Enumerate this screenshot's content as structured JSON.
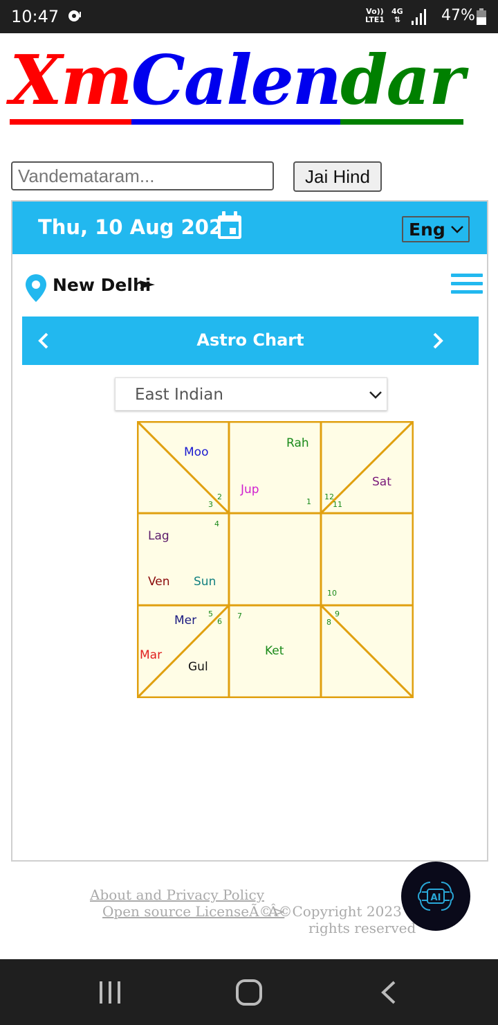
{
  "status_bar": {
    "time": "10:47",
    "network_top": "Vo))",
    "network_bottom": "LTE1",
    "network_type": "4G",
    "battery": "47%"
  },
  "logo": {
    "part1": "Xm",
    "part2": "Calen",
    "part3": "dar",
    "colors": [
      "#ff0000",
      "#0000ee",
      "#008000"
    ]
  },
  "search": {
    "placeholder": "Vandemataram...",
    "button_label": "Jai Hind"
  },
  "header": {
    "date": "Thu, 10 Aug 2023",
    "language": "Eng",
    "accent": "#22b8ef"
  },
  "location": {
    "city": "New Delhi"
  },
  "chart_nav": {
    "title": "Astro Chart"
  },
  "chart_style": {
    "selected": "East Indian"
  },
  "astro_chart": {
    "planets": {
      "moo": "Moo",
      "rah": "Rah",
      "jup": "Jup",
      "sat": "Sat",
      "lag": "Lag",
      "ven": "Ven",
      "sun": "Sun",
      "mer": "Mer",
      "mar": "Mar",
      "gul": "Gul",
      "ket": "Ket"
    },
    "houses": [
      "1",
      "2",
      "3",
      "4",
      "5",
      "6",
      "7",
      "8",
      "9",
      "10",
      "11",
      "12"
    ]
  },
  "footer": {
    "privacy": "About and Privacy Policy",
    "license": "Open source LicenseÃ©>",
    "copyright_a": "Â©Copyright 2023 all",
    "copyright_b": "rights reserved"
  },
  "ai_button": {
    "label": "AI"
  }
}
